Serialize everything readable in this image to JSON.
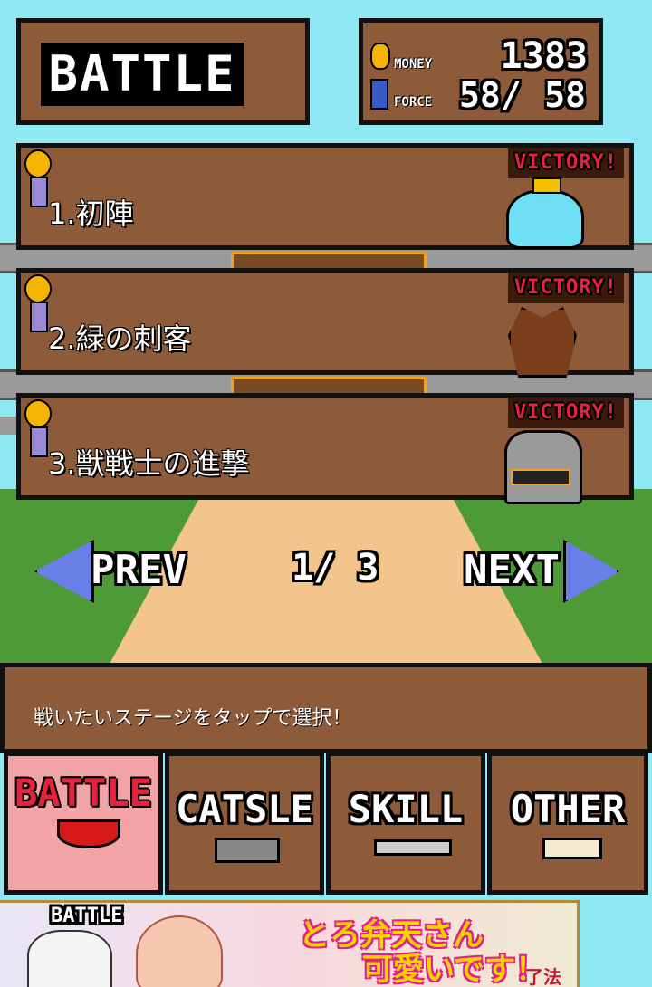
{
  "header": {
    "title": "BATTLE",
    "money_label": "MONEY",
    "money_value": "1383",
    "force_label": "FORCE",
    "force_current": "58/",
    "force_max": "58"
  },
  "stages": [
    {
      "title": "1.初陣",
      "badge": "VICTORY!",
      "enemy": "blue-slime-icon"
    },
    {
      "title": "2.緑の刺客",
      "badge": "VICTORY!",
      "enemy": "tree-monster-icon"
    },
    {
      "title": "3.獣戦士の進撃",
      "badge": "VICTORY!",
      "enemy": "beast-warrior-icon"
    }
  ],
  "pagination": {
    "prev_label": "PREV",
    "page_text": "1/ 3",
    "next_label": "NEXT"
  },
  "message": "戦いたいステージをタップで選択！",
  "tabs": [
    {
      "label": "BATTLE",
      "icon": "horns-icon",
      "active": true
    },
    {
      "label": "CATSLE",
      "icon": "castle-icon",
      "active": false
    },
    {
      "label": "SKILL",
      "icon": "sword-icon",
      "active": false
    },
    {
      "label": "OTHER",
      "icon": "book-icon",
      "active": false
    }
  ],
  "ad": {
    "label": "BATTLE",
    "headline": "とろ弁天さん",
    "headline2": "可愛いです！",
    "logo": "了法寺"
  },
  "colors": {
    "sky": "#8fe7f4",
    "wood": "#8e5b3a",
    "grass": "#4e9a37",
    "path": "#f3c48c",
    "active_tab": "#f2a3a5",
    "victory": "#e8223a"
  }
}
